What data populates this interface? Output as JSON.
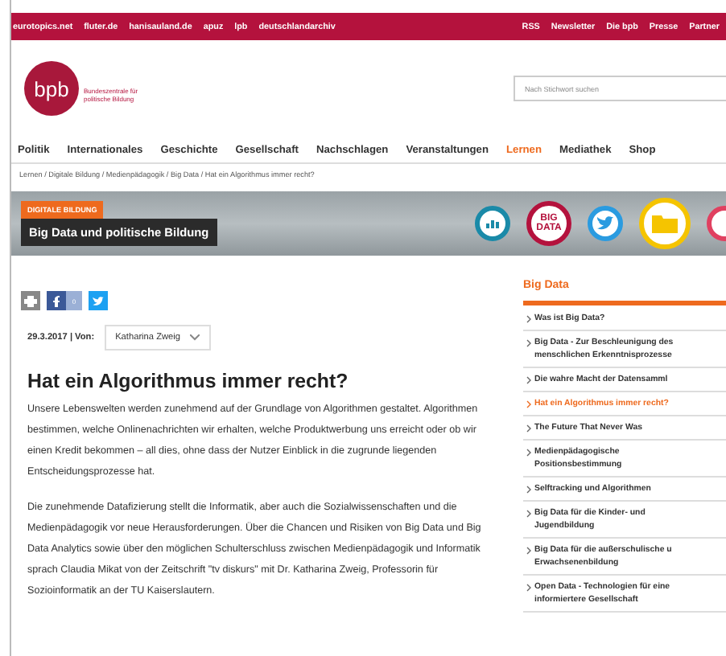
{
  "top_links": [
    "eurotopics.net",
    "fluter.de",
    "hanisauland.de",
    "apuz",
    "lpb",
    "deutschlandarchiv"
  ],
  "top_right_links": [
    "RSS",
    "Newsletter",
    "Die bpb",
    "Presse",
    "Partner"
  ],
  "logo": {
    "mark": "bpb",
    "tagline": "Bundeszentrale für politische Bildung"
  },
  "search": {
    "placeholder": "Nach Stichwort suchen"
  },
  "nav": [
    {
      "label": "Politik",
      "selected": false
    },
    {
      "label": "Internationales",
      "selected": false
    },
    {
      "label": "Geschichte",
      "selected": false
    },
    {
      "label": "Gesellschaft",
      "selected": false
    },
    {
      "label": "Nachschlagen",
      "selected": false
    },
    {
      "label": "Veranstaltungen",
      "selected": false
    },
    {
      "label": "Lernen",
      "selected": true
    },
    {
      "label": "Mediathek",
      "selected": false
    },
    {
      "label": "Shop",
      "selected": false
    }
  ],
  "breadcrumb": "Lernen / Digitale Bildung / Medienpädagogik / Big Data / Hat ein Algorithmus immer recht?",
  "banner": {
    "tag": "DIGITALE BILDUNG",
    "title": "Big Data und politische Bildung",
    "badge": "BIG DATA"
  },
  "share": {
    "facebook_count": "0"
  },
  "meta": {
    "date": "29.3.2017 | Von:",
    "author": "Katharina Zweig"
  },
  "article": {
    "title": "Hat ein Algorithmus immer recht?",
    "paragraphs": [
      "Unsere Lebenswelten werden zunehmend auf der Grundlage von Algorithmen gestaltet. Algorithmen bestimmen, welche Onlinenachrichten wir erhalten, welche Produktwerbung uns erreicht oder ob wir einen Kredit bekommen – all dies, ohne dass der Nutzer Einblick in die zugrunde liegenden Entscheidungsprozesse hat.",
      "Die zunehmende Datafizierung stellt die Informatik, aber auch die Sozialwissenschaften und die Medienpädagogik vor neue Herausforderungen. Über die Chancen und Risiken von Big Data und Big Data Analytics sowie über den möglichen Schulterschluss zwischen Medienpädagogik und Informatik sprach Claudia Mikat von der Zeitschrift \"tv diskurs\" mit Dr. Katharina Zweig, Professorin für Sozioinformatik an der TU Kaiserslautern."
    ]
  },
  "sidebar": {
    "title": "Big Data",
    "items": [
      {
        "lines": [
          "Was ist Big Data?"
        ],
        "selected": false
      },
      {
        "lines": [
          "Big Data - Zur Beschleunigung des",
          "menschlichen Erkenntnisprozesse"
        ],
        "selected": false
      },
      {
        "lines": [
          "Die wahre Macht der Datensamml"
        ],
        "selected": false
      },
      {
        "lines": [
          "Hat ein Algorithmus immer recht?"
        ],
        "selected": true
      },
      {
        "lines": [
          "The Future That Never Was"
        ],
        "selected": false
      },
      {
        "lines": [
          "Medienpädagogische",
          "Positionsbestimmung"
        ],
        "selected": false
      },
      {
        "lines": [
          "Selftracking und Algorithmen"
        ],
        "selected": false
      },
      {
        "lines": [
          "Big Data für die Kinder- und",
          "Jugendbildung"
        ],
        "selected": false
      },
      {
        "lines": [
          "Big Data für die außerschulische u",
          "Erwachsenenbildung"
        ],
        "selected": false
      },
      {
        "lines": [
          "Open Data - Technologien für eine",
          "informiertere Gesellschaft"
        ],
        "selected": false
      }
    ]
  }
}
